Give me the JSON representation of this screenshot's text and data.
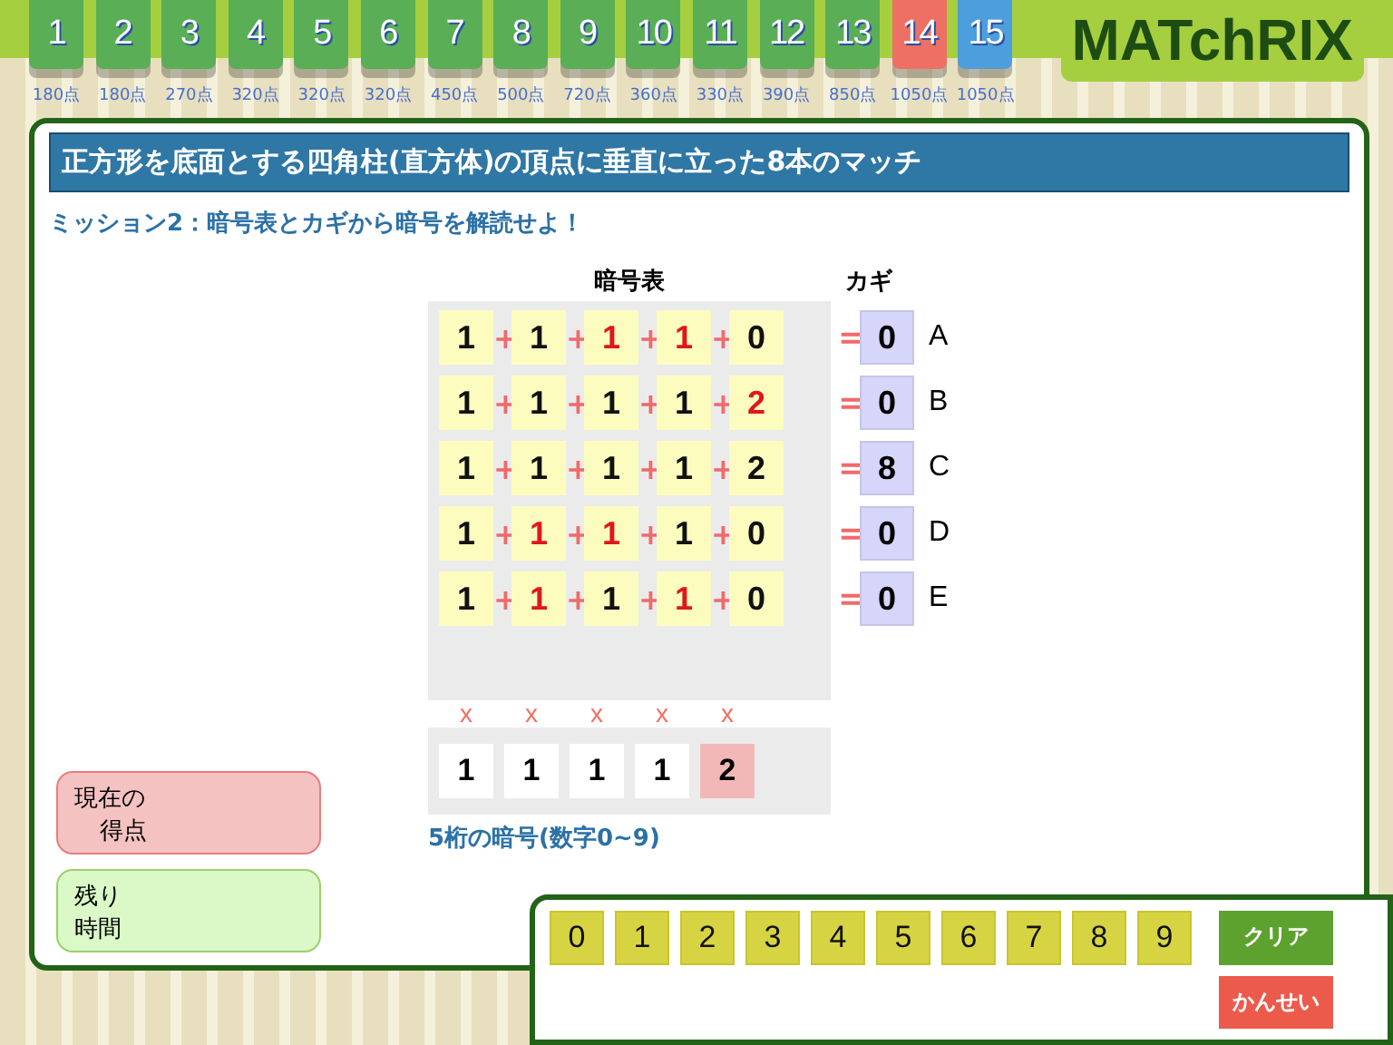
{
  "levels": [
    {
      "number": "1",
      "points": "180点",
      "color": "#5aae55"
    },
    {
      "number": "2",
      "points": "180点",
      "color": "#5aae55"
    },
    {
      "number": "3",
      "points": "270点",
      "color": "#5aae55"
    },
    {
      "number": "4",
      "points": "320点",
      "color": "#5aae55"
    },
    {
      "number": "5",
      "points": "320点",
      "color": "#5aae55"
    },
    {
      "number": "6",
      "points": "320点",
      "color": "#5aae55"
    },
    {
      "number": "7",
      "points": "450点",
      "color": "#5aae55"
    },
    {
      "number": "8",
      "points": "500点",
      "color": "#5aae55"
    },
    {
      "number": "9",
      "points": "720点",
      "color": "#5aae55"
    },
    {
      "number": "10",
      "points": "360点",
      "color": "#5aae55"
    },
    {
      "number": "11",
      "points": "330点",
      "color": "#5aae55"
    },
    {
      "number": "12",
      "points": "390点",
      "color": "#5aae55"
    },
    {
      "number": "13",
      "points": "850点",
      "color": "#5aae55"
    },
    {
      "number": "14",
      "points": "1050点",
      "color": "#ee6f63"
    },
    {
      "number": "15",
      "points": "1050点",
      "color": "#4d9edc"
    }
  ],
  "logo": "MATchRIX",
  "title": "正方形を底面とする四角柱(直方体)の頂点に垂直に立った8本のマッチ",
  "mission": "ミッション2：暗号表とカギから暗号を解読せよ！",
  "table": {
    "heading": "暗号表",
    "key_heading": "カギ",
    "plus": "+",
    "equals": "=",
    "rows": [
      {
        "cells": [
          {
            "value": "1",
            "highlighted": false
          },
          {
            "value": "1",
            "highlighted": false
          },
          {
            "value": "1",
            "highlighted": true
          },
          {
            "value": "1",
            "highlighted": true
          },
          {
            "value": "0",
            "highlighted": false
          }
        ],
        "key": "0",
        "label": "A"
      },
      {
        "cells": [
          {
            "value": "1",
            "highlighted": false
          },
          {
            "value": "1",
            "highlighted": false
          },
          {
            "value": "1",
            "highlighted": false
          },
          {
            "value": "1",
            "highlighted": false
          },
          {
            "value": "2",
            "highlighted": true
          }
        ],
        "key": "0",
        "label": "B"
      },
      {
        "cells": [
          {
            "value": "1",
            "highlighted": false
          },
          {
            "value": "1",
            "highlighted": false
          },
          {
            "value": "1",
            "highlighted": false
          },
          {
            "value": "1",
            "highlighted": false
          },
          {
            "value": "2",
            "highlighted": false
          }
        ],
        "key": "8",
        "label": "C"
      },
      {
        "cells": [
          {
            "value": "1",
            "highlighted": false
          },
          {
            "value": "1",
            "highlighted": true
          },
          {
            "value": "1",
            "highlighted": true
          },
          {
            "value": "1",
            "highlighted": false
          },
          {
            "value": "0",
            "highlighted": false
          }
        ],
        "key": "0",
        "label": "D"
      },
      {
        "cells": [
          {
            "value": "1",
            "highlighted": false
          },
          {
            "value": "1",
            "highlighted": true
          },
          {
            "value": "1",
            "highlighted": false
          },
          {
            "value": "1",
            "highlighted": true
          },
          {
            "value": "0",
            "highlighted": false
          }
        ],
        "key": "0",
        "label": "E"
      }
    ]
  },
  "answer": {
    "digits": [
      {
        "mark": "x",
        "value": "1",
        "selected": false
      },
      {
        "mark": "x",
        "value": "1",
        "selected": false
      },
      {
        "mark": "x",
        "value": "1",
        "selected": false
      },
      {
        "mark": "x",
        "value": "1",
        "selected": false
      },
      {
        "mark": "x",
        "value": "2",
        "selected": true
      }
    ],
    "note": "5桁の暗号(数字0~9)"
  },
  "score": {
    "label_1": "現在の",
    "label_2": "得点"
  },
  "time": {
    "label_1": "残り",
    "label_2": "時間"
  },
  "keypad": [
    "0",
    "1",
    "2",
    "3",
    "4",
    "5",
    "6",
    "7",
    "8",
    "9"
  ],
  "buttons": {
    "clear": "クリア",
    "submit": "かんせい"
  }
}
